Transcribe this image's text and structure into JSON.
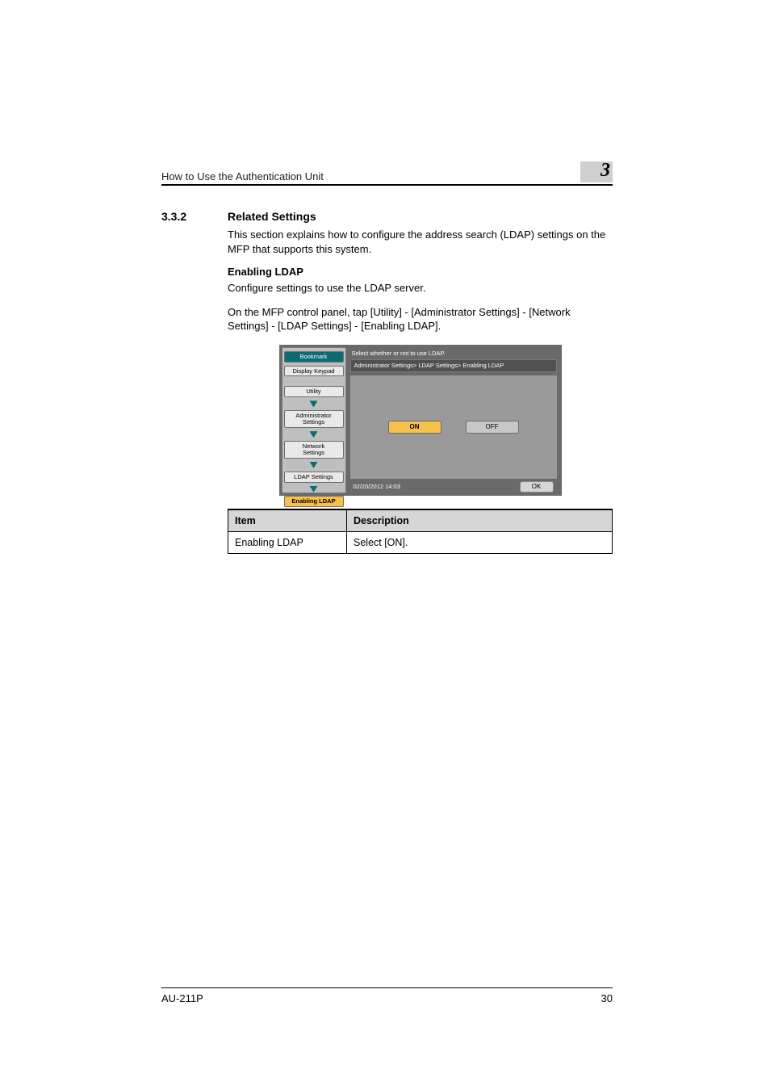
{
  "header": {
    "running_title": "How to Use the Authentication Unit",
    "chapter_number": "3"
  },
  "section": {
    "number": "3.3.2",
    "title": "Related Settings",
    "intro": "This section explains how to configure the address search (LDAP) settings on the MFP that supports this system.",
    "sub_heading": "Enabling LDAP",
    "sub_p1": "Configure settings to use the LDAP server.",
    "sub_p2": "On the MFP control panel, tap [Utility] - [Administrator Settings] - [Network Settings] - [LDAP Settings] - [Enabling LDAP]."
  },
  "panel": {
    "instruction": "Select whether or not to use LDAP.",
    "breadcrumb": "Administrator Settings> LDAP Settings> Enabling LDAP",
    "option_on": "ON",
    "option_off": "OFF",
    "timestamp": "02/20/2012   14:03",
    "ok_label": "OK",
    "side": {
      "bookmark": "Bookmark",
      "display_keypad": "Display Keypad",
      "utility": "Utility",
      "admin_settings": "Administrator\nSettings",
      "network_settings": "Network\nSettings",
      "ldap_settings": "LDAP Settings",
      "enabling_ldap": "Enabling LDAP"
    }
  },
  "table": {
    "head_item": "Item",
    "head_desc": "Description",
    "rows": [
      {
        "item": "Enabling LDAP",
        "desc": "Select [ON]."
      }
    ]
  },
  "footer": {
    "model": "AU-211P",
    "page_number": "30"
  }
}
